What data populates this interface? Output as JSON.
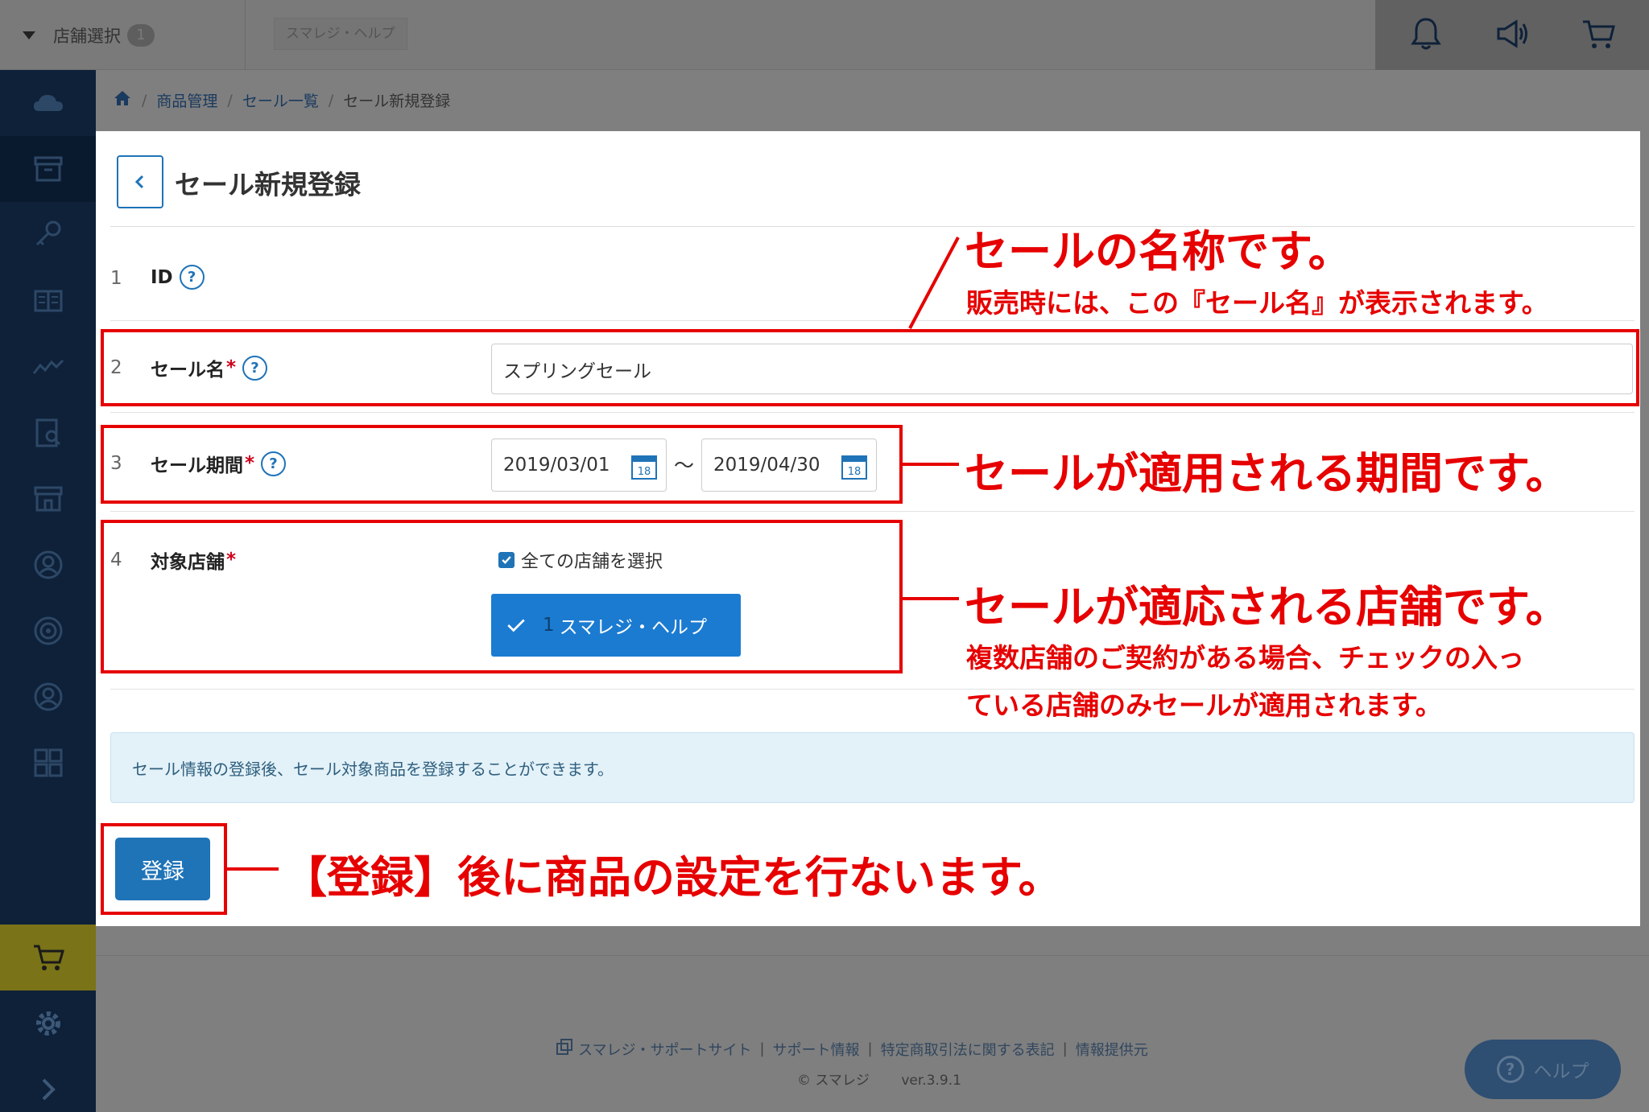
{
  "topbar": {
    "store_select_label": "店舗選択",
    "store_count": "1",
    "current_store_tab": "スマレジ・ヘルプ"
  },
  "breadcrumb": {
    "items": [
      "商品管理",
      "セール一覧",
      "セール新規登録"
    ]
  },
  "page": {
    "title": "セール新規登録"
  },
  "form": {
    "rows": [
      {
        "number": "1",
        "label": "ID",
        "required": false
      },
      {
        "number": "2",
        "label": "セール名",
        "required": true
      },
      {
        "number": "3",
        "label": "セール期間",
        "required": true
      },
      {
        "number": "4",
        "label": "対象店舗",
        "required": true
      }
    ],
    "required_mark": "*",
    "help_mark": "?",
    "sale_name_value": "スプリングセール",
    "date_from": "2019/03/01",
    "date_to": "2019/04/30",
    "date_separator": "〜",
    "calendar_day": "18",
    "select_all_label": "全ての店舗を選択",
    "store_chip_number": "1",
    "store_chip_name": "スマレジ・ヘルプ"
  },
  "info_message": "セール情報の登録後、セール対象商品を登録することができます。",
  "register_button": "登録",
  "footer": {
    "links": [
      "スマレジ・サポートサイト",
      "サポート情報",
      "特定商取引法に関する表記",
      "情報提供元"
    ],
    "link_separator": "|",
    "copyright": "© スマレジ",
    "version": "ver.3.9.1",
    "help_button": "ヘルプ"
  },
  "annotations": {
    "name_title": "セールの名称です。",
    "name_sub": "販売時には、この『セール名』が表示されます。",
    "period": "セールが適用される期間です。",
    "store_title": "セールが適応される店舗です。",
    "store_sub_1": "複数店舗のご契約がある場合、チェックの入っ",
    "store_sub_2": "ている店舗のみセールが適用されます。",
    "register": "【登録】後に商品の設定を行ないます。"
  },
  "colors": {
    "annotation_red": "#e60000",
    "primary_blue": "#1f73b7",
    "sidebar_navy": "#0e2139"
  }
}
